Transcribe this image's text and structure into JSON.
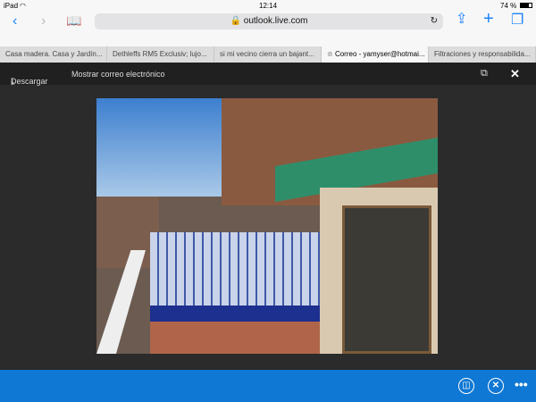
{
  "status": {
    "device": "iPad",
    "time": "12:14",
    "battery": "74 %"
  },
  "browser": {
    "url": "outlook.live.com"
  },
  "tabs": [
    {
      "label": "Casa madera. Casa y Jardín..."
    },
    {
      "label": "Dethleffs RM5 Exclusiv; lujo..."
    },
    {
      "label": "si mi vecino cierra un bajant..."
    },
    {
      "label": "Correo - yamyser@hotmai...",
      "active": true
    },
    {
      "label": "Filtraciones y responsabilida..."
    }
  ],
  "viewer": {
    "download_label": "Descargar",
    "show_email_label": "Mostrar correo electrónico"
  },
  "colors": {
    "accent": "#1a82fb",
    "bottom_bar": "#0f78d4"
  }
}
